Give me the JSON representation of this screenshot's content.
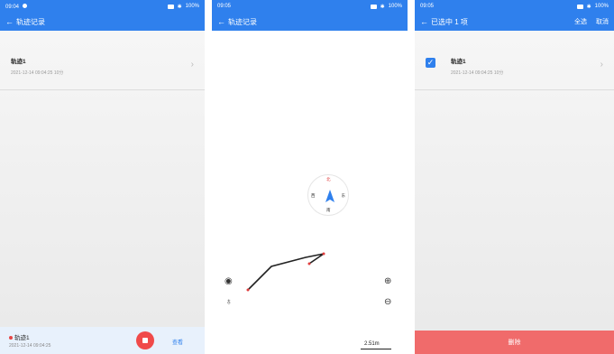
{
  "screen1": {
    "status_time": "09:04",
    "battery": "100%",
    "app_title": "轨迹记录",
    "track_name": "轨迹1",
    "track_meta": "2021-12-14 09:04:25 10分",
    "recording": {
      "name": "轨迹1",
      "time": "2021-12-14 09:04:25",
      "view_label": "查看"
    }
  },
  "screen2": {
    "status_time": "09:05",
    "battery": "100%",
    "app_title": "轨迹记录",
    "compass": {
      "north": "北",
      "east": "东",
      "south": "南",
      "west": "西"
    },
    "scale_label": "2.51m"
  },
  "screen3": {
    "status_time": "09:05",
    "battery": "100%",
    "app_title": "已选中 1 项",
    "select_all": "全选",
    "cancel": "取消",
    "track_name": "轨迹1",
    "track_meta": "2021-12-14 09:04:25 10分",
    "delete_label": "删除"
  },
  "colors": {
    "primary": "#2f80ed",
    "record": "#f04a4a",
    "delete": "#f06b6b"
  }
}
